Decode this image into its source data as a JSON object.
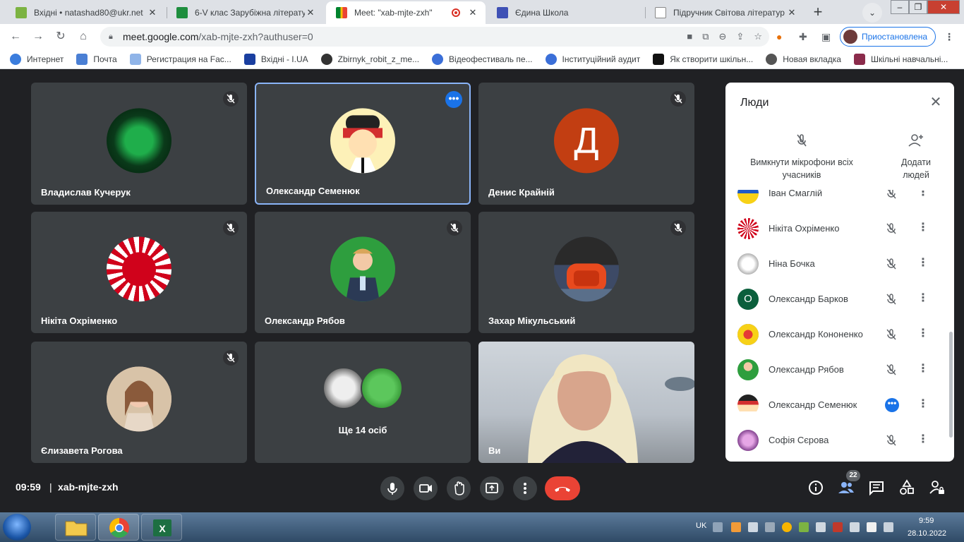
{
  "browser": {
    "tabs": [
      {
        "title": "Вхідні • natashad80@ukr.net",
        "favicon": "mail-icon"
      },
      {
        "title": "6-V клас Зарубіжна літератур",
        "favicon": "classroom-icon"
      },
      {
        "title": "Meet: \"xab-mjte-zxh\"",
        "favicon": "meet-icon",
        "active": true
      },
      {
        "title": "Єдина Школа",
        "favicon": "school-icon"
      },
      {
        "title": "Підручник Світова літератур",
        "favicon": "book-icon"
      }
    ],
    "url_host": "meet.google.com",
    "url_path": "/xab-mjte-zxh?authuser=0",
    "profile_label": "Приостановлена",
    "bookmarks": [
      {
        "label": "Интернет",
        "color": "#3b7ddd"
      },
      {
        "label": "Почта",
        "color": "#4a7fd4"
      },
      {
        "label": "Регистрация на Fac...",
        "color": "#8fb4e8"
      },
      {
        "label": "Вхідні - I.UA",
        "color": "#1a3fa0"
      },
      {
        "label": "Zbirnyk_robit_z_me...",
        "color": "#333333"
      },
      {
        "label": "Відеофестиваль пе...",
        "color": "#3b6fd8"
      },
      {
        "label": "Інституційний аудит",
        "color": "#3b6fd8"
      },
      {
        "label": "Як створити шкільн...",
        "color": "#111111"
      },
      {
        "label": "Новая вкладка",
        "color": "#555555"
      },
      {
        "label": "Шкільні навчальні...",
        "color": "#8b2b4b"
      }
    ]
  },
  "meet": {
    "tiles": [
      {
        "name": "Владислав Кучерук",
        "muted": true
      },
      {
        "name": "Олександр Семенюк",
        "muted": false,
        "focused": true
      },
      {
        "name": "Денис Крайній",
        "muted": true,
        "letter": "Д"
      },
      {
        "name": "Нікіта Охріменко",
        "muted": true
      },
      {
        "name": "Олександр Рябов",
        "muted": true
      },
      {
        "name": "Захар Мікульський",
        "muted": true
      },
      {
        "name": "Єлизавета Рогова",
        "muted": true
      },
      {
        "name": "",
        "more_label": "Ще 14 осіб"
      },
      {
        "name": "Ви",
        "self": true
      }
    ],
    "time": "09:59",
    "separator": "|",
    "code": "xab-mjte-zxh",
    "participant_count": "22"
  },
  "panel": {
    "title": "Люди",
    "mute_all_label": "Вимкнути мікрофони всіх учасників",
    "add_people_label": "Додати людей",
    "participants": [
      {
        "name": "Іван Смаглій",
        "status": "muted"
      },
      {
        "name": "Нікіта Охріменко",
        "status": "muted"
      },
      {
        "name": "Ніна Бочка",
        "status": "muted"
      },
      {
        "name": "Олександр Барков",
        "status": "muted",
        "letter": "О"
      },
      {
        "name": "Олександр Кононенко",
        "status": "muted"
      },
      {
        "name": "Олександр Рябов",
        "status": "muted"
      },
      {
        "name": "Олександр Семенюк",
        "status": "active"
      },
      {
        "name": "Софія Сєрова",
        "status": "muted"
      }
    ]
  },
  "taskbar": {
    "lang": "UK",
    "time": "9:59",
    "date": "28.10.2022"
  }
}
